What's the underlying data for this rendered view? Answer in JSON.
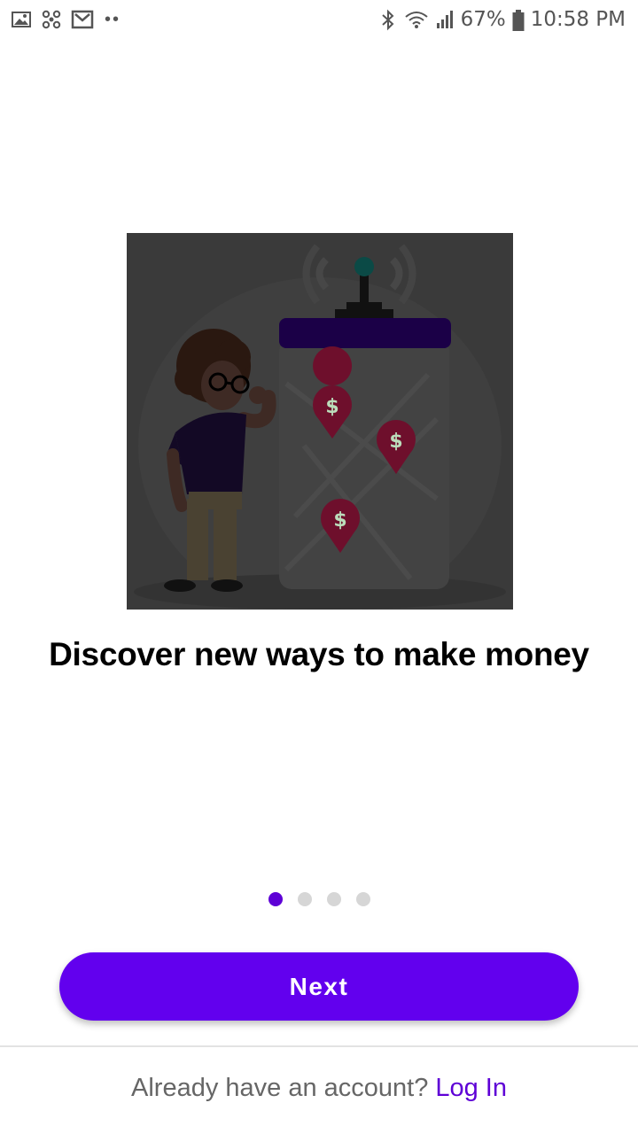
{
  "status_bar": {
    "battery": "67%",
    "time": "10:58 PM",
    "more_indicator": "••",
    "left_icons": [
      "image-icon",
      "pinwheel-icon",
      "gmail-icon"
    ],
    "right_icons": [
      "bluetooth-icon",
      "wifi-icon",
      "signal-icon",
      "battery-icon"
    ]
  },
  "onboarding": {
    "headline": "Discover new ways to make money",
    "pages_total": 4,
    "active_page": 1
  },
  "actions": {
    "next_label": "Next"
  },
  "footer": {
    "prompt": "Already have an account?",
    "login_label": "Log In"
  },
  "colors": {
    "accent": "#6200ee",
    "dot_inactive": "#d6d6d6",
    "illustration_bg": "#3a3a3a"
  }
}
